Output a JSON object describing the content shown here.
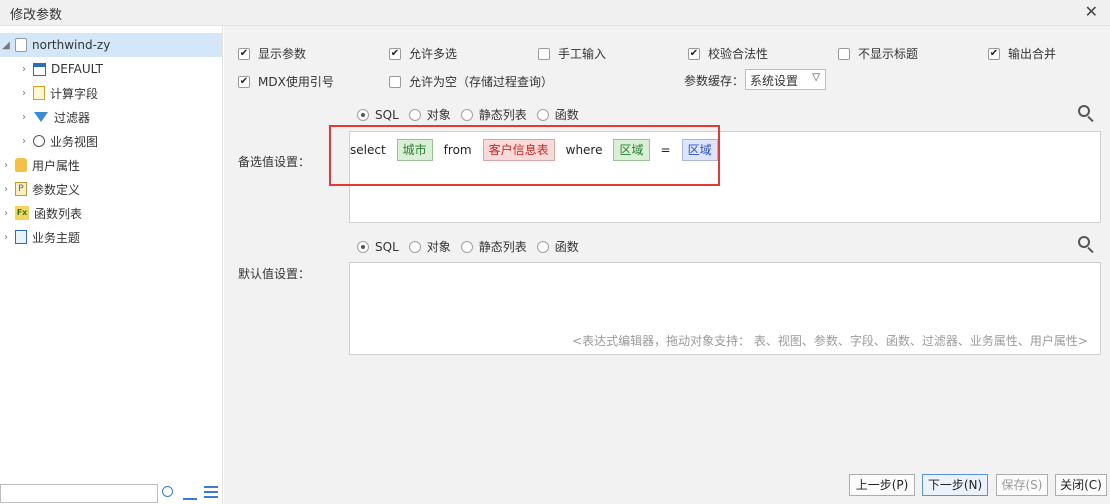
{
  "window": {
    "title": "修改参数",
    "close": "✕"
  },
  "tree": {
    "root": "northwind-zy",
    "items": [
      {
        "label": "DEFAULT",
        "icon": "table-icon"
      },
      {
        "label": "计算字段",
        "icon": "calc-field-icon"
      },
      {
        "label": "过滤器",
        "icon": "filter-icon"
      },
      {
        "label": "业务视图",
        "icon": "search-icon"
      },
      {
        "label": "用户属性",
        "icon": "hand-icon"
      },
      {
        "label": "参数定义",
        "icon": "param-icon"
      },
      {
        "label": "函数列表",
        "icon": "fx-icon"
      },
      {
        "label": "业务主题",
        "icon": "theme-icon"
      }
    ],
    "search_value": ""
  },
  "options": {
    "show_params": {
      "label": "显示参数",
      "checked": true
    },
    "multi_select": {
      "label": "允许多选",
      "checked": true
    },
    "manual_input": {
      "label": "手工输入",
      "checked": false
    },
    "validate": {
      "label": "校验合法性",
      "checked": true
    },
    "hide_title": {
      "label": "不显示标题",
      "checked": false
    },
    "output_merge": {
      "label": "输出合并",
      "checked": true
    },
    "mdx_ref": {
      "label": "MDX使用引号",
      "checked": true
    },
    "allow_null": {
      "label": "允许为空（存储过程查询）",
      "checked": false
    },
    "cache_label": "参数缓存：",
    "cache_value": "系统设置"
  },
  "candidate": {
    "label": "备选值设置：",
    "radios": [
      "SQL",
      "对象",
      "静态列表",
      "函数"
    ],
    "selected": "SQL",
    "sql": {
      "select": "select",
      "field": "城市",
      "from": "from",
      "table": "客户信息表",
      "where": "where",
      "cond_field": "区域",
      "eq": "=",
      "param": "区域"
    }
  },
  "default": {
    "label": "默认值设置：",
    "radios": [
      "SQL",
      "对象",
      "静态列表",
      "函数"
    ],
    "selected": "SQL",
    "hint": "<表达式编辑器，拖动对象支持： 表、视图、参数、字段、函数、过滤器、业务属性、用户属性>"
  },
  "buttons": {
    "prev": "上一步(P)",
    "next": "下一步(N)",
    "save": "保存(S)",
    "close": "关闭(C)"
  }
}
